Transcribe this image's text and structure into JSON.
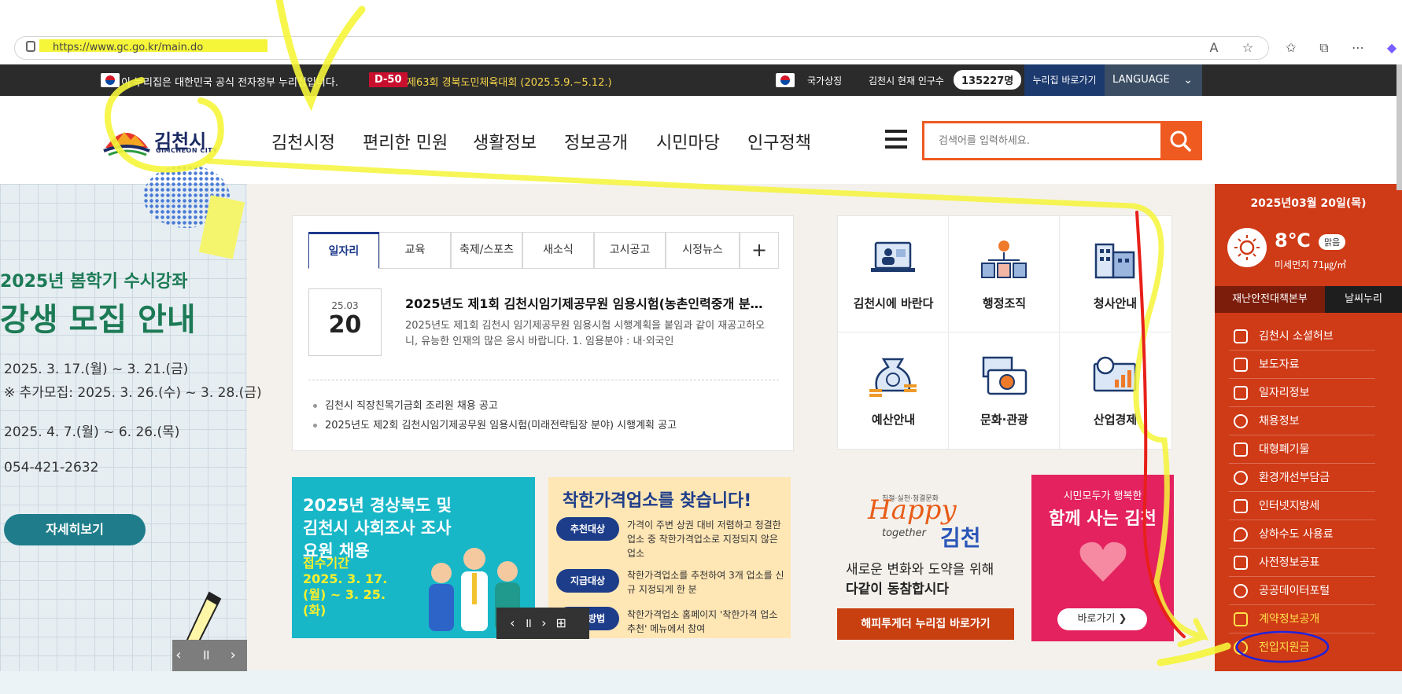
{
  "browser": {
    "url": "https://www.gc.go.kr/main.do"
  },
  "govbar": {
    "notice": "이 누리집은 대한민국 공식 전자정부 누리집입니다.",
    "dday": "D-50",
    "event": "제63회 경북도민체육대회 (2025.5.9.~5.12.)",
    "national_symbol": "국가상징",
    "population_label": "김천시 현재 인구수",
    "population_value": "135227명",
    "shortcut": "누리집 바로가기",
    "language": "LANGUAGE"
  },
  "header": {
    "logo_text": "김천시",
    "logo_sub": "GIMCHEON CITY",
    "nav": [
      "김천시정",
      "편리한 민원",
      "생활정보",
      "정보공개",
      "시민마당",
      "인구정책"
    ],
    "search_placeholder": "검색어를 입력하세요."
  },
  "left_banner": {
    "title1": "2025년 봄학기 수시강좌",
    "title2": "강생 모집 안내",
    "line1": "2025. 3. 17.(월) ~ 3. 21.(금)",
    "line2": "※ 추가모집: 2025. 3. 26.(수) ~ 3. 28.(금)",
    "line3": "2025. 4. 7.(월) ~ 6. 26.(목)",
    "line4": "054-421-2632",
    "button": "자세히보기"
  },
  "news": {
    "tabs": [
      "일자리",
      "교육",
      "축제/스포츠",
      "새소식",
      "고시공고",
      "시정뉴스"
    ],
    "add": "+",
    "date_month": "25.03",
    "date_day": "20",
    "title": "2025년도 제1회 김천시임기제공무원 임용시험(농촌인력중개 분…",
    "desc": "2025년도 제1회 김천시 임기제공무원 임용시험 시행계획을 붙임과 같이 재공고하오니, 유능한 인재의 많은 응시 바랍니다. 1. 임용분야 : 내·외국인",
    "items": [
      "김천시 직장친목기금회 조리원 채용 공고",
      "2025년도 제2회 김천시임기제공무원 임용시험(미래전략팀장 분야) 시행계획 공고"
    ]
  },
  "quick": [
    "김천시에 바란다",
    "행정조직",
    "청사안내",
    "예산안내",
    "문화·관광",
    "산업경제"
  ],
  "banner1": {
    "title": "2025년 경상북도 및 김천시 사회조사 조사요원 채용",
    "period_label": "접수기간",
    "period": "2025. 3. 17.(월) ~ 3. 25.(화)"
  },
  "banner2": {
    "title": "착한가격업소를 찾습니다!",
    "rows": [
      {
        "label": "추천대상",
        "text": "가격이 주변 상권 대비 저렴하고 청결한 업소 중 착한가격업소로 지정되지 않은 업소"
      },
      {
        "label": "지급대상",
        "text": "착한가격업소를 추천하여 3개 업소를 신규 지정되게 한 분"
      },
      {
        "label": "추천방법",
        "text": "착한가격업소 홈페이지 '착한가격 업소 추천' 메뉴에서 참여"
      }
    ]
  },
  "happy": {
    "logo_small": "친절·실천·청결문화",
    "logo_main": "Happy",
    "logo_together": "together",
    "logo_city": "김천",
    "text1": "새로운 변화와 도약을 위해",
    "text2": "다같이 동참합시다",
    "button": "해피투게더 누리집 바로가기"
  },
  "together": {
    "sub": "시민모두가 행복한",
    "title": "함께 사는 김천",
    "button": "바로가기 ❯"
  },
  "right_panel": {
    "date": "2025년03월 20일(목)",
    "temp": "8℃",
    "condition": "맑음",
    "dust": "미세먼지 71㎍/㎥",
    "tab1": "재난안전대책본부",
    "tab2": "날씨누리",
    "items": [
      "김천시 소셜허브",
      "보도자료",
      "일자리정보",
      "채용정보",
      "대형폐기물",
      "환경개선부담금",
      "인터넷지방세",
      "상하수도 사용료",
      "사전정보공표",
      "공공데이터포털",
      "계약정보공개",
      "전입지원금"
    ]
  },
  "colors": {
    "accent": "#ee5a1f",
    "panel": "#cf3a17",
    "navy": "#1d3a8a",
    "highlight": "#f5f53a"
  }
}
